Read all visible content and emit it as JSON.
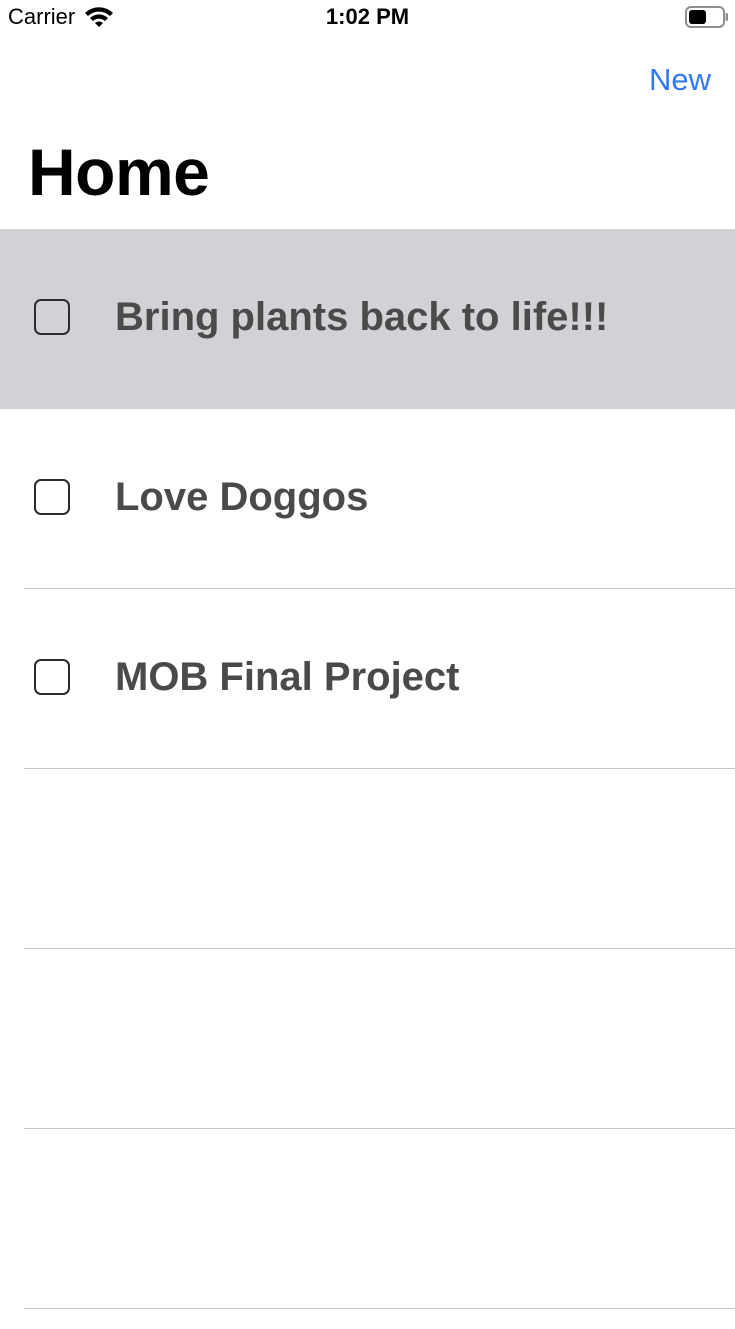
{
  "status_bar": {
    "carrier": "Carrier",
    "time": "1:02 PM",
    "wifi_icon": "wifi-icon",
    "battery_icon": "battery-icon"
  },
  "nav": {
    "new_label": "New",
    "title": "Home",
    "accent_color": "#3478f6"
  },
  "tasks": [
    {
      "title": "Bring plants back to life!!!",
      "checked": false,
      "selected": true
    },
    {
      "title": "Love Doggos",
      "checked": false,
      "selected": false
    },
    {
      "title": "MOB Final Project",
      "checked": false,
      "selected": false
    }
  ],
  "colors": {
    "selected_row": "#d1d1d6",
    "task_text": "#4a4a4a"
  }
}
